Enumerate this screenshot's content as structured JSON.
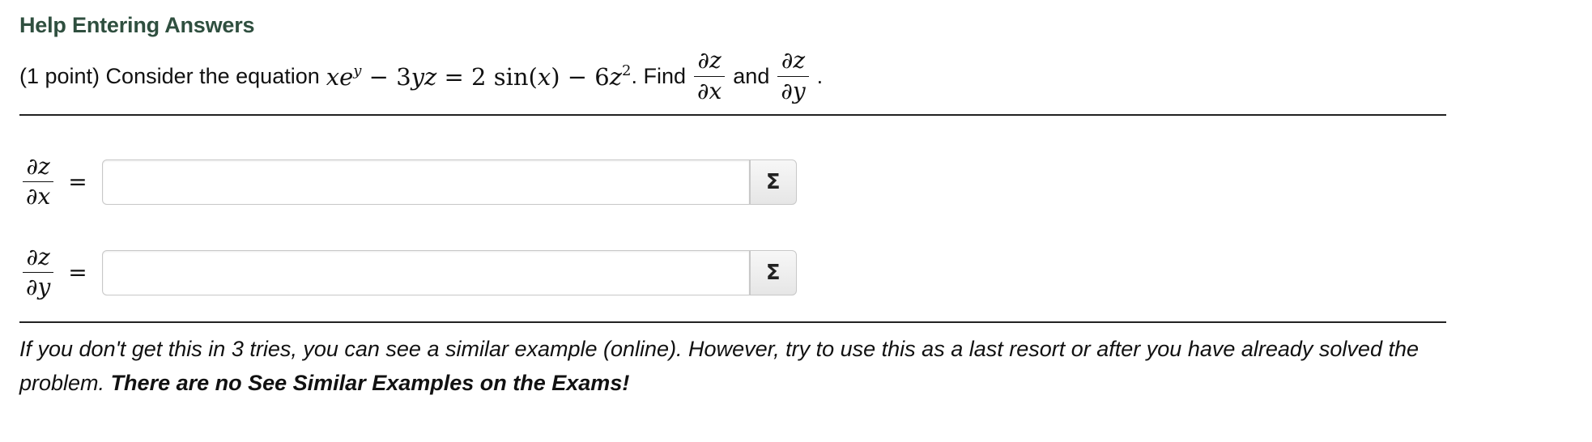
{
  "help_link": "Help Entering Answers",
  "problem": {
    "prefix": "(1 point) Consider the equation",
    "equation": {
      "x": "x",
      "e": "e",
      "exp": "y",
      "minus1": " − 3",
      "yz": "yz",
      "eq": " = 2 sin(",
      "x2": "x",
      "close": ") − 6",
      "z": "z",
      "sq": "2"
    },
    "after_equation": ". Find",
    "and": "and",
    "period": ".",
    "frac1": {
      "num": "∂z",
      "den": "∂x"
    },
    "frac2": {
      "num": "∂z",
      "den": "∂y"
    }
  },
  "answers": [
    {
      "lhs_num": "∂z",
      "lhs_den": "∂x",
      "equals": "=",
      "value": "",
      "placeholder": "",
      "button": "Σ"
    },
    {
      "lhs_num": "∂z",
      "lhs_den": "∂y",
      "equals": "=",
      "value": "",
      "placeholder": "",
      "button": "Σ"
    }
  ],
  "note": {
    "italic": "If you don't get this in 3 tries, you can see a similar example (online). However, try to use this as a last resort or after you have already solved the problem. ",
    "bold": "There are no See Similar Examples on the Exams!"
  }
}
